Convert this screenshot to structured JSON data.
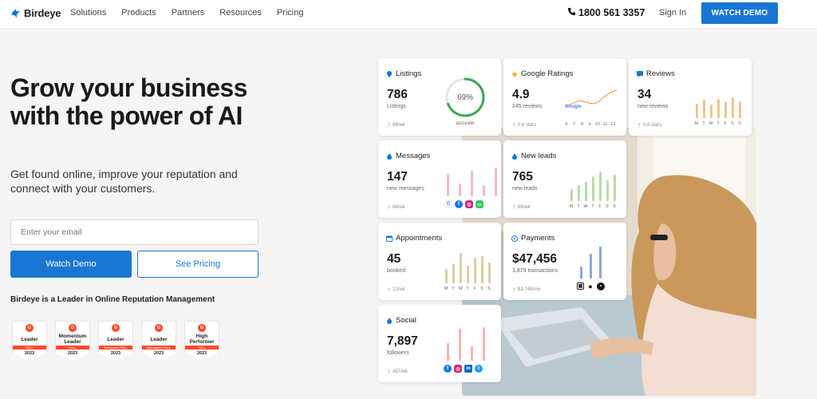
{
  "nav": {
    "brand": "Birdeye",
    "links": [
      "Solutions",
      "Products",
      "Partners",
      "Resources",
      "Pricing"
    ],
    "phone": "1800 561 3357",
    "signin": "Sign In",
    "watch_demo": "WATCH DEMO"
  },
  "hero": {
    "headline": "Grow your business with the power of AI",
    "subhead": "Get found online, improve your reputation and connect with your customers.",
    "email_placeholder": "Enter your email",
    "demo_button": "Watch Demo",
    "pricing_button": "See Pricing",
    "leader_text": "Birdeye is a Leader in Online Reputation Management"
  },
  "badges": [
    {
      "title": "Leader",
      "season": "FALL",
      "year": "2023"
    },
    {
      "title": "Momentum Leader",
      "season": "FALL",
      "year": "2023"
    },
    {
      "title": "Leader",
      "season": "Enterprise FALL",
      "year": "2023"
    },
    {
      "title": "Leader",
      "season": "Mid-Market FALL",
      "year": "2023"
    },
    {
      "title": "High Performer",
      "season": "FALL",
      "year": "2023"
    }
  ],
  "cards": {
    "listings": {
      "title": "Listings",
      "value": "786",
      "sub": "Listings",
      "foot": "86/wk",
      "percent": "69%",
      "percent_label": "accurate",
      "fill": 0.69
    },
    "ratings": {
      "title": "Google Ratings",
      "value": "4.9",
      "sub": "245 reviews",
      "foot": "0.6 stars",
      "axis": [
        "6",
        "7",
        "8",
        "9",
        "10",
        "11",
        "12"
      ],
      "chart_label": "Google"
    },
    "reviews": {
      "title": "Reviews",
      "value": "34",
      "sub": "new reviews",
      "foot": "0.6 stars",
      "days": [
        "M",
        "T",
        "W",
        "T",
        "F",
        "S",
        "S"
      ],
      "bars": [
        0.6,
        0.75,
        0.55,
        0.8,
        0.65,
        0.85,
        0.7
      ]
    },
    "messages": {
      "title": "Messages",
      "value": "147",
      "sub": "new messages",
      "foot": "86/wk",
      "bars": [
        0.7,
        0.4,
        0.8,
        0.35,
        0.9
      ]
    },
    "leads": {
      "title": "New leads",
      "value": "765",
      "sub": "new leads",
      "foot": "86/wk",
      "days": [
        "M",
        "T",
        "W",
        "T",
        "F",
        "S",
        "S"
      ],
      "bars": [
        0.35,
        0.45,
        0.55,
        0.7,
        0.85,
        0.6,
        0.75
      ]
    },
    "appointments": {
      "title": "Appointments",
      "value": "45",
      "sub": "booked",
      "foot": "12/wk",
      "days": [
        "M",
        "T",
        "W",
        "T",
        "F",
        "S",
        "S"
      ],
      "bars": [
        0.45,
        0.6,
        0.95,
        0.55,
        0.8,
        0.85,
        0.65
      ]
    },
    "payments": {
      "title": "Payments",
      "value": "$47,456",
      "sub": "3,879 transactions",
      "foot": "$3,745/mo",
      "bars": [
        0.35,
        0.7,
        0.9
      ]
    },
    "social": {
      "title": "Social",
      "value": "7,897",
      "sub": "followers",
      "foot": "457/wk",
      "bars": [
        0.5,
        0.9,
        0.4,
        0.95
      ]
    }
  },
  "colors": {
    "accent": "#1976d2",
    "reviews_bar": "#f0c48a",
    "messages_bar": "#f2b8d3",
    "leads_bar": "#b9dba9",
    "appt_bar": "#d9cfa0",
    "payments_bar": "#8fa6d6",
    "social_bar": "#f0b6ab"
  }
}
